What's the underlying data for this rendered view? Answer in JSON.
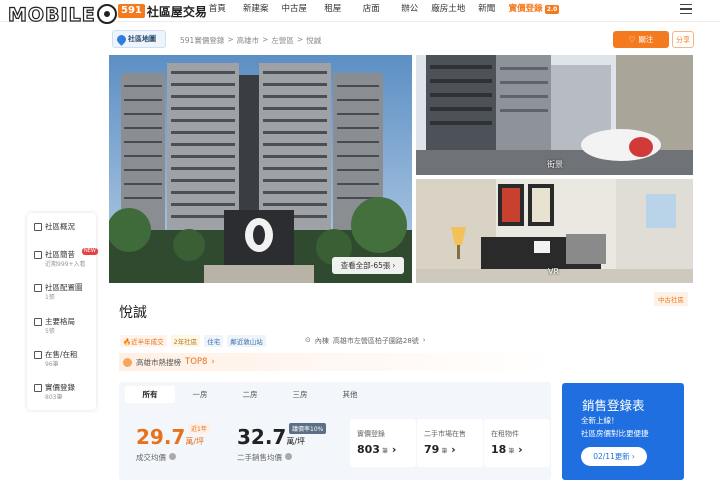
{
  "watermark": "MOBILE",
  "brand": {
    "badge": "591",
    "text": "社區屋交易"
  },
  "nav": {
    "items": [
      "首頁",
      "新建案",
      "中古屋",
      "租屋",
      "店面",
      "辦公",
      "廠房土地",
      "新聞"
    ],
    "active": {
      "label": "實價登錄",
      "badge": "2.0"
    }
  },
  "breadcrumb": {
    "map_button": "社區地圖",
    "trail": [
      "591實價登錄",
      ">",
      "高雄市",
      ">",
      "左營區",
      ">",
      "悅誠"
    ]
  },
  "actions": {
    "follow": "關注",
    "share": "分享"
  },
  "gallery": {
    "see_all": "查看全部-65張",
    "street_tag": "街景",
    "vr_tag": "VR"
  },
  "sidebar": {
    "items": [
      {
        "label": "社區概況",
        "sub": ""
      },
      {
        "label": "社區簡昔",
        "sub": "近期999+入看"
      },
      {
        "label": "社區配置圖",
        "sub": "1張"
      },
      {
        "label": "主要格局",
        "sub": "5張"
      },
      {
        "label": "在售/在租",
        "sub": "96筆"
      },
      {
        "label": "實價登錄",
        "sub": "803筆"
      }
    ],
    "new_badge": "NEW"
  },
  "community": {
    "name": "悅誠",
    "type_badge": "中古社區",
    "tags": [
      "近半年成交",
      "2年社區",
      "住宅",
      "鄰近敦山站"
    ],
    "address_prefix": "內棟",
    "address": "高雄市左營區柏子園路28號"
  },
  "rank": {
    "label": "高雄市熱搜榜",
    "value": "TOP8"
  },
  "room_tabs": [
    "所有",
    "一房",
    "二房",
    "三房",
    "其他"
  ],
  "prices": {
    "deal": {
      "value": "29.7",
      "unit": "萬/坪",
      "label": "成交均價",
      "badge": "近1年",
      "color": "#e8711b"
    },
    "listing": {
      "value": "32.7",
      "unit": "萬/坪",
      "label": "二手銷售均價",
      "badge": "議價率10%",
      "color": "#222222"
    }
  },
  "stats": [
    {
      "label": "實價登錄",
      "value": "803",
      "unit": "筆"
    },
    {
      "label": "二手市場在售",
      "value": "79",
      "unit": "筆"
    },
    {
      "label": "在租物件",
      "value": "18",
      "unit": "筆"
    }
  ],
  "promo": {
    "title": "銷售登錄表",
    "line1": "全新上線！",
    "line2": "社區房價對比更便捷",
    "button": "02/11更新"
  },
  "colors": {
    "accent": "#f47a20",
    "promo_blue": "#1f6fe0"
  }
}
